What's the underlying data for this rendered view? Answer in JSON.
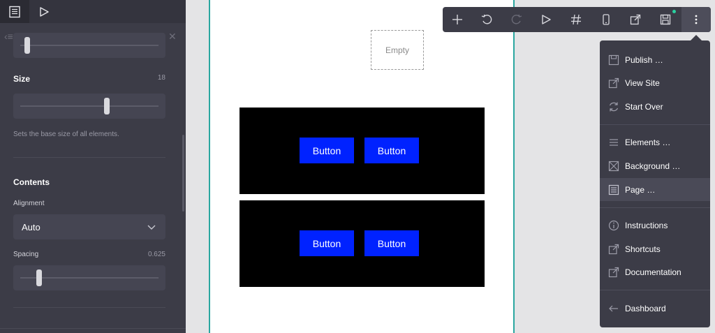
{
  "panel": {
    "tabs": [
      {
        "name": "page-tab",
        "icon": "document-icon"
      },
      {
        "name": "preview-tab",
        "icon": "play-icon"
      }
    ],
    "size": {
      "label": "Size",
      "value": "18",
      "help": "Sets the base size of all elements.",
      "level": 0.63
    },
    "top_slider_level": 0.03,
    "contents": {
      "heading": "Contents",
      "alignment_label": "Alignment",
      "alignment_value": "Auto",
      "spacing_label": "Spacing",
      "spacing_value": "0.625",
      "spacing_level": 0.12
    }
  },
  "canvas": {
    "empty_label": "Empty",
    "blocks": [
      {
        "buttons": [
          "Button",
          "Button"
        ]
      },
      {
        "buttons": [
          "Button",
          "Button"
        ]
      }
    ]
  },
  "toolbar": {
    "buttons": [
      "add-icon",
      "undo-icon",
      "redo-icon",
      "play-icon",
      "hash-icon",
      "mobile-icon",
      "external-link-icon",
      "save-icon",
      "more-icon"
    ]
  },
  "menu": {
    "groups": [
      [
        {
          "label": "Publish …",
          "icon": "save-icon"
        },
        {
          "label": "View Site",
          "icon": "external-link-icon"
        },
        {
          "label": "Start Over",
          "icon": "refresh-icon"
        }
      ],
      [
        {
          "label": "Elements …",
          "icon": "list-icon"
        },
        {
          "label": "Background …",
          "icon": "image-icon"
        },
        {
          "label": "Page …",
          "icon": "document-icon",
          "active": true
        }
      ],
      [
        {
          "label": "Instructions",
          "icon": "info-icon"
        },
        {
          "label": "Shortcuts",
          "icon": "external-link-icon"
        },
        {
          "label": "Documentation",
          "icon": "external-link-icon"
        }
      ],
      [
        {
          "label": "Dashboard",
          "icon": "arrow-left-icon"
        }
      ]
    ]
  },
  "colors": {
    "accent": "#2aa7a0",
    "button_blue": "#0022ff",
    "panel_bg": "#3c3c47",
    "badge": "#2ad1a0"
  }
}
